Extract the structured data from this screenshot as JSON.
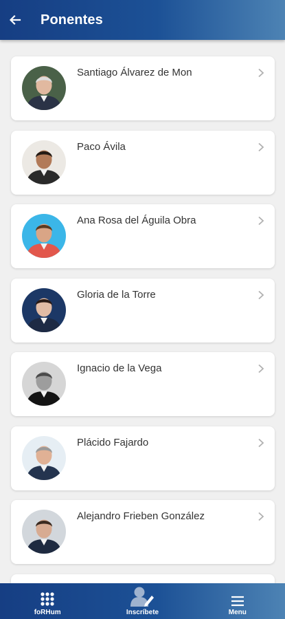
{
  "header": {
    "title": "Ponentes",
    "back_icon": "arrow-left-icon"
  },
  "speakers": [
    {
      "name": "Santiago Álvarez de Mon",
      "avatar_bg": "#4a6148",
      "skin": "#e1b9a0",
      "hair": "#dcdcdc",
      "suit": "#2b3346"
    },
    {
      "name": "Paco Ávila",
      "avatar_bg": "#ece9e4",
      "skin": "#b27a58",
      "hair": "#231a14",
      "suit": "#2a2a2a"
    },
    {
      "name": "Ana Rosa del Águila Obra",
      "avatar_bg": "#3bb6e8",
      "skin": "#d9a586",
      "hair": "#5a3a22",
      "suit": "#e2574c"
    },
    {
      "name": "Gloria de la Torre",
      "avatar_bg": "#1c3866",
      "skin": "#e2bca5",
      "hair": "#2a1b16",
      "suit": "#1d2a44"
    },
    {
      "name": "Ignacio de la Vega",
      "avatar_bg": "#d6d6d6",
      "skin": "#9d9d9d",
      "hair": "#4a4a4a",
      "suit": "#141414"
    },
    {
      "name": "Plácido Fajardo",
      "avatar_bg": "#e6eef4",
      "skin": "#e0b195",
      "hair": "#9a9a9a",
      "suit": "#24344f"
    },
    {
      "name": "Alejandro Frieben González",
      "avatar_bg": "#d2d7dc",
      "skin": "#d7ab92",
      "hair": "#3a2a20",
      "suit": "#1e2a40"
    },
    {
      "name": "",
      "avatar_bg": "#4b5563",
      "skin": "#c9a48c",
      "hair": "#333333",
      "suit": "#2a2a2a"
    }
  ],
  "bottom_nav": [
    {
      "label": "foRHum",
      "icon": "grid-icon"
    },
    {
      "label": "Inscríbete",
      "icon": "user-edit-icon"
    },
    {
      "label": "Menu",
      "icon": "hamburger-icon"
    }
  ],
  "colors": {
    "brand_dark": "#163e83",
    "brand_light": "#4d83b4",
    "background": "#f0f0f0",
    "card": "#ffffff",
    "text": "#333333",
    "chevron": "#b0b0b0"
  }
}
